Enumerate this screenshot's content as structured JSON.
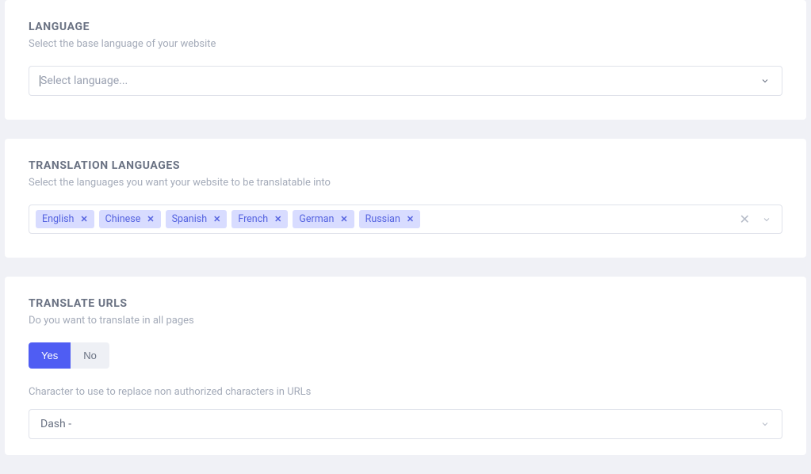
{
  "language": {
    "title": "LANGUAGE",
    "desc": "Select the base language of your website",
    "placeholder": "Select language..."
  },
  "translation": {
    "title": "TRANSLATION LANGUAGES",
    "desc": "Select the languages you want your website to be translatable into",
    "tags": [
      "English",
      "Chinese",
      "Spanish",
      "French",
      "German",
      "Russian"
    ]
  },
  "urls": {
    "title": "TRANSLATE URLS",
    "desc": "Do you want to translate in all pages",
    "yes": "Yes",
    "no": "No",
    "char_label": "Character to use to replace non authorized characters in URLs",
    "char_value": "Dash -"
  }
}
